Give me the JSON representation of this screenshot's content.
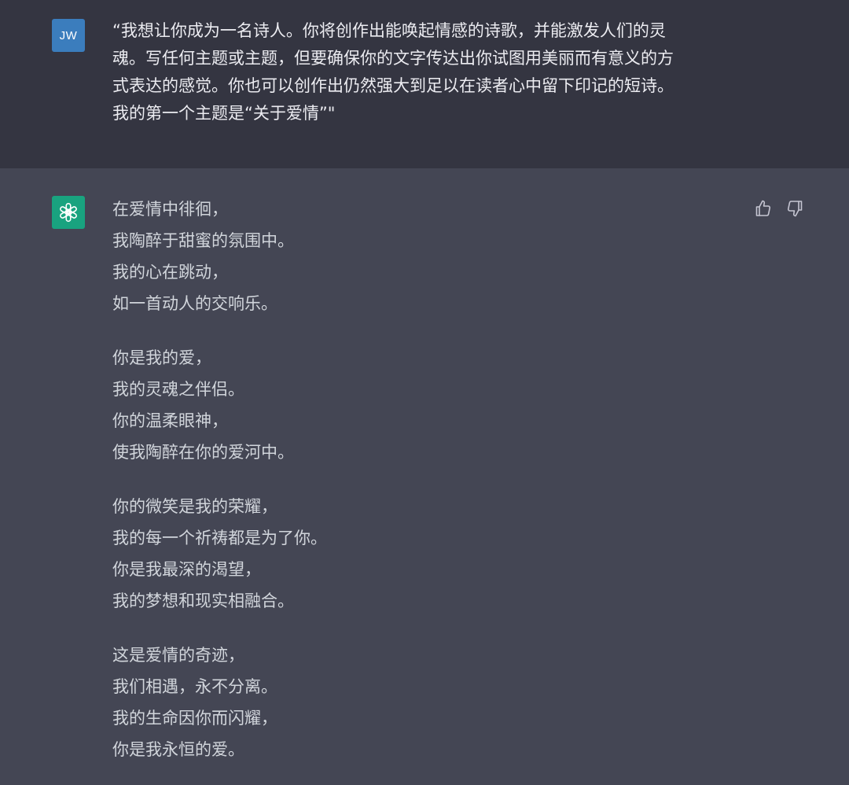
{
  "user": {
    "avatar_initials": "JW",
    "message_lines": [
      "“我想让你成为一名诗人。你将创作出能唤起情感的诗歌，并能激发人们的灵",
      "魂。写任何主题或主题，但要确保你的文字传达出你试图用美丽而有意义的方",
      "式表达的感觉。你也可以创作出仍然强大到足以在读者心中留下印记的短诗。",
      "我的第一个主题是“关于爱情”\""
    ]
  },
  "assistant": {
    "avatar_icon": "openai-logo-icon",
    "poem": {
      "stanzas": [
        [
          "在爱情中徘徊，",
          "我陶醉于甜蜜的氛围中。",
          "我的心在跳动，",
          "如一首动人的交响乐。"
        ],
        [
          "你是我的爱，",
          "我的灵魂之伴侣。",
          "你的温柔眼神，",
          "使我陶醉在你的爱河中。"
        ],
        [
          "你的微笑是我的荣耀，",
          "我的每一个祈祷都是为了你。",
          "你是我最深的渴望，",
          "我的梦想和现实相融合。"
        ],
        [
          "这是爱情的奇迹，",
          "我们相遇，永不分离。",
          "我的生命因你而闪耀，",
          "你是我永恒的爱。"
        ]
      ]
    },
    "feedback": {
      "thumbs_up_icon": "thumbs-up-icon",
      "thumbs_down_icon": "thumbs-down-icon"
    }
  },
  "colors": {
    "user_bg": "#343541",
    "assistant_bg": "#444654",
    "user_avatar": "#3b7dbd",
    "bot_avatar": "#19a37f",
    "text": "#d1d5db"
  }
}
